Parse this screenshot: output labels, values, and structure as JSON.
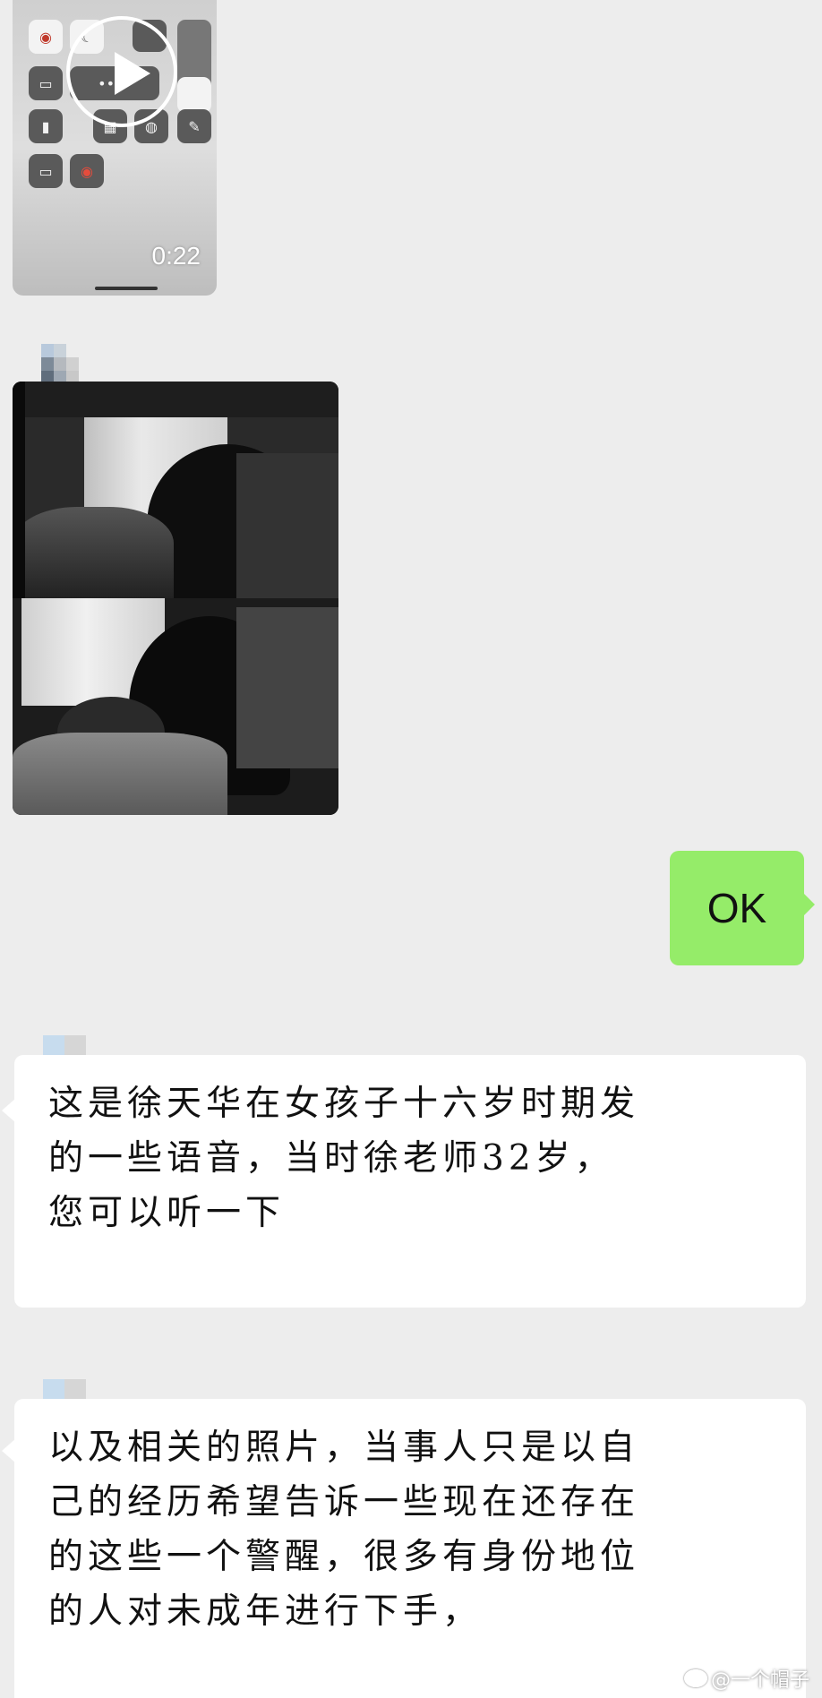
{
  "video_message": {
    "duration": "0:22",
    "play_icon": "play-icon"
  },
  "messages": {
    "ok_reply": {
      "text": "OK",
      "bubble_color": "#95ec69"
    },
    "text_message_1": {
      "lines": [
        "这是徐天华在女孩子十六岁时期发",
        "的一些语音，当时徐老师32岁，",
        "您可以听一下"
      ]
    },
    "text_message_2": {
      "lines": [
        "以及相关的照片，当事人只是以自",
        "己的经历希望告诉一些现在还存在",
        "的这些一个警醒，很多有身份地位",
        "的人对未成年进行下手，"
      ]
    }
  },
  "watermark": {
    "text": "@一个帽子",
    "icon": "weibo-icon"
  },
  "colors": {
    "background": "#ededed",
    "incoming_bubble": "#ffffff",
    "outgoing_bubble": "#95ec69"
  }
}
